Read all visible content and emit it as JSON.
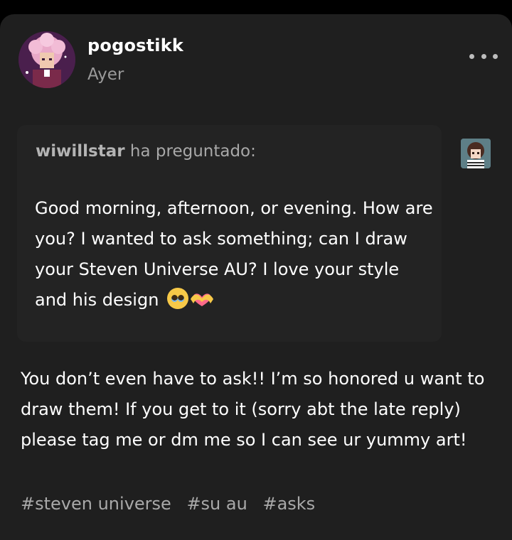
{
  "post": {
    "author": "pogostikk",
    "timestamp": "Ayer",
    "more_icon": "more-horizontal-icon"
  },
  "ask": {
    "asker": "wiwillstar",
    "asked_label": "ha preguntado:",
    "text": "Good morning, afternoon, or evening. How are you? I wanted to ask something; can I draw your Steven Universe AU? I love your style and his design",
    "emojis": [
      "pleading-face-icon",
      "heart-hands-icon"
    ]
  },
  "reply": {
    "text": "You don’t even have to ask!! I’m so honored u want to draw them! If you get to it (sorry abt the late reply) please tag me or dm me so I can see ur yummy art!"
  },
  "tags": [
    "#steven universe",
    "#su au",
    "#asks"
  ],
  "colors": {
    "background": "#000000",
    "card": "#1f1f1f",
    "ask_box": "#232323",
    "text_primary": "#ffffff",
    "text_secondary": "#9a9a9a"
  }
}
